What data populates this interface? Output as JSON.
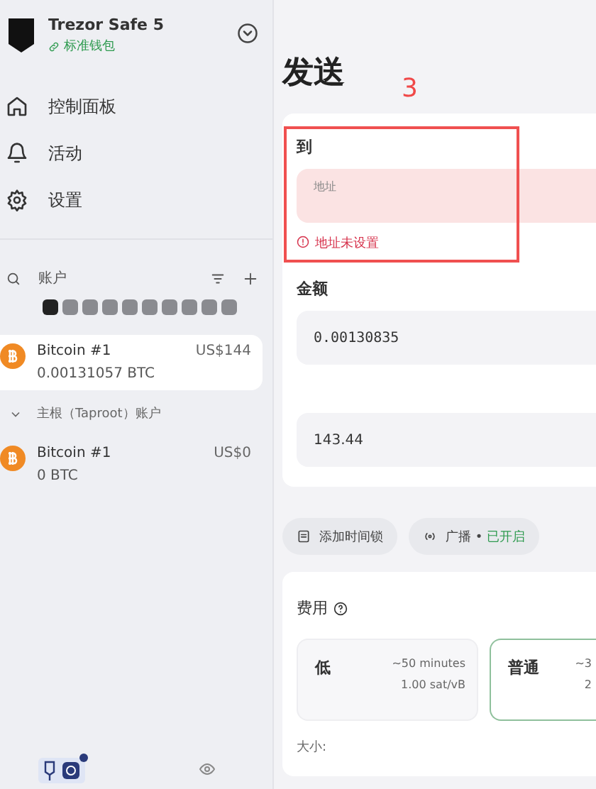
{
  "sidebar": {
    "device": {
      "name": "Trezor Safe 5",
      "wallet": "标准钱包"
    },
    "nav": [
      {
        "label": "控制面板"
      },
      {
        "label": "活动"
      },
      {
        "label": "设置"
      }
    ],
    "accounts_label": "账户",
    "coin_filters": [
      {
        "selected": true
      },
      {
        "selected": false
      },
      {
        "selected": false
      },
      {
        "selected": false
      },
      {
        "selected": false
      },
      {
        "selected": false
      },
      {
        "selected": false
      },
      {
        "selected": false
      },
      {
        "selected": false
      },
      {
        "selected": false
      }
    ],
    "accounts": [
      {
        "name": "Bitcoin #1",
        "fiat": "US$144",
        "balance": "0.00131057 BTC",
        "selected": true
      }
    ],
    "group": {
      "label": "主根（Taproot）账户",
      "expanded": true,
      "accounts": [
        {
          "name": "Bitcoin #1",
          "fiat": "US$0",
          "balance": "0 BTC",
          "selected": false
        }
      ]
    }
  },
  "main": {
    "title": "发送",
    "annotation": {
      "number": "3"
    },
    "to": {
      "label": "到",
      "placeholder": "地址",
      "error": "地址未设置"
    },
    "amount": {
      "label": "金额",
      "value": "0.00130835",
      "fiat_value": "143.44"
    },
    "options": [
      {
        "kind": "timelock",
        "label": "添加时间锁"
      },
      {
        "kind": "broadcast",
        "label": "广播 • ",
        "status": "已开启"
      }
    ],
    "fee": {
      "label": "费用",
      "levels": [
        {
          "name": "低",
          "time": "~50 minutes",
          "rate": "1.00 sat/vB",
          "selected": false
        },
        {
          "name": "普通",
          "time": "~3",
          "rate": "2",
          "selected": true
        }
      ],
      "size_label": "大小:"
    }
  }
}
